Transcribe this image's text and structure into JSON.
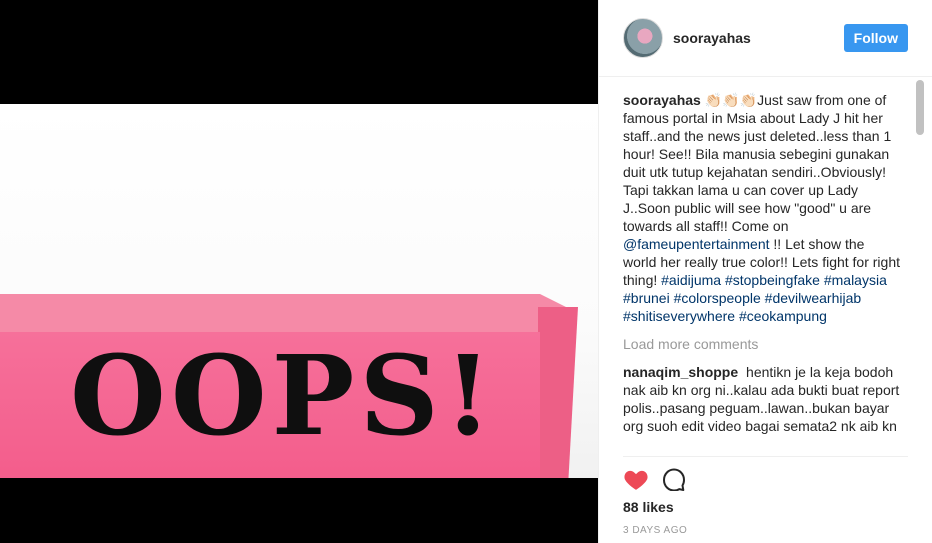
{
  "post": {
    "username": "soorayahas",
    "follow_label": "Follow",
    "image_text": "OOPS!",
    "caption": {
      "user": "soorayahas",
      "emoji": "👏🏻👏🏻👏🏻",
      "text_before_mention": "Just saw from one of famous portal in Msia about Lady J hit her staff..and the news just deleted..less than 1 hour! See!! Bila manusia sebegini gunakan duit utk tutup kejahatan sendiri..Obviously! Tapi takkan lama u can cover up Lady J..Soon public will see how \"good\" u are towards all staff!! Come on",
      "mention": "@fameupentertainment",
      "text_after_mention": "!! Let show the world her really true color!! Lets fight for right thing!",
      "hashtags": [
        "#aidijuma",
        "#stopbeingfake",
        "#malaysia",
        "#brunei",
        "#colorspeople",
        "#devilwearhijab",
        "#shitiseverywhere",
        "#ceokampung"
      ]
    },
    "load_more_label": "Load more comments",
    "comments": [
      {
        "user": "nanaqim_shoppe",
        "text": "hentikn je la keja bodoh nak aib kn org ni..kalau ada bukti buat report polis..pasang peguam..lawan..bukan bayar org suoh edit video bagai semata2 nk aib kn"
      }
    ],
    "likes": "88 likes",
    "timestamp": "3 DAYS AGO",
    "icons": {
      "like": "heart-icon",
      "comment": "comment-bubble-icon"
    },
    "colors": {
      "follow_bg": "#3897f0",
      "like_red": "#ed4956",
      "hashtag": "#003569"
    }
  }
}
